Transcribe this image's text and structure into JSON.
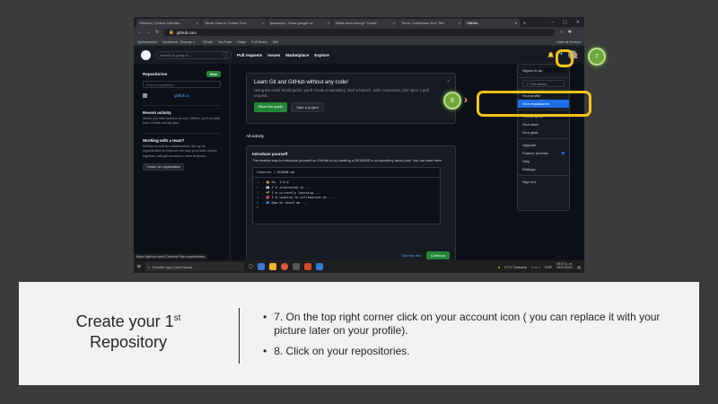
{
  "browser": {
    "tabs": [
      {
        "label": "Director | Online Courses -",
        "active": false
      },
      {
        "label": "Tema: How to Create Your",
        "active": false
      },
      {
        "label": "javascript - Pass google sc",
        "active": false
      },
      {
        "label": "What went wrong? Troubl",
        "active": false
      },
      {
        "label": "Tema: Customize Your Terr",
        "active": false
      },
      {
        "label": "GitHub",
        "active": true
      }
    ],
    "new_tab": "+",
    "url": "github.com",
    "bookmarks": [
      "Aplicaciones",
      "facebook - Buscar c...",
      "Gmail",
      "YouTube",
      "Maps",
      "Full Stack",
      "DM"
    ],
    "reading_list": "Lista de lectura"
  },
  "github": {
    "search_placeholder": "Search or jump to...",
    "search_key": "/",
    "nav": [
      "Pull requests",
      "Issues",
      "Marketplace",
      "Explore"
    ],
    "sidebar": {
      "repos_title": "Repositories",
      "new_label": "New",
      "find_placeholder": "Find a repository...",
      "repo_name": "github.io",
      "recent_title": "Recent activity",
      "recent_text": "When you take actions across GitHub, we'll provide links to that activity here.",
      "team_title": "Working with a team?",
      "team_text": "GitHub is built for collaboration. Set up an organization to improve the way your team works together, and get access to more features.",
      "org_button": "Create an organization"
    },
    "welcome": {
      "title": "Learn Git and GitHub without any code!",
      "text": "Using the Hello World guide, you'll create a repository, start a branch, write comments, and open a pull request.",
      "read_button": "Read the guide",
      "start_button": "Start a project",
      "close": "×"
    },
    "activity_title": "All activity",
    "intro": {
      "title": "Introduce yourself",
      "text": "The easiest way to introduce yourself on GitHub is by creating a README in a repository about you! You can start here:",
      "file": "CJamrcel / README.md",
      "lines": [
        {
          "n": "1",
          "t": "- 👋 Hi, I'm @"
        },
        {
          "n": "2",
          "t": "- 👀 I'm interested in ..."
        },
        {
          "n": "3",
          "t": "- 🌱 I'm currently learning ..."
        },
        {
          "n": "4",
          "t": "- 💞 I'm looking to collaborate on ..."
        },
        {
          "n": "5",
          "t": "- 📫 How to reach me ..."
        },
        {
          "n": "6",
          "t": ""
        }
      ],
      "dismiss": "Dismiss this",
      "continue": "Continue"
    },
    "dropdown": {
      "signed_in": "Signed in as",
      "set_status": "Set status",
      "items_a": [
        "Your profile",
        "Your repositories"
      ],
      "items_b": [
        "Your projects",
        "Your stars",
        "Your gists"
      ],
      "items_c": [
        "Upgrade",
        "Feature preview",
        "Help",
        "Settings"
      ],
      "sign_out": "Sign out"
    },
    "status_url": "https://github.com/CJamrcel?tab=repositories"
  },
  "taskbar": {
    "search_placeholder": "Escribe aquí para buscar",
    "weather": "27°C Soleado",
    "lang": "ESP",
    "time": "04:57 p. m.",
    "date": "06/07/2021"
  },
  "annotations": {
    "step7": "7",
    "step8": "8"
  },
  "caption": {
    "title_a": "Create your 1",
    "title_sup": "st",
    "title_b": "Repository",
    "bullets": [
      "7. On the top right corner click on your account icon ( you can replace it with your picture later on your profile).",
      "8. Click on your repositories."
    ]
  },
  "colors": {
    "highlight": "#f5c219",
    "badge": "#6fa83a",
    "github_green": "#238636",
    "github_link": "#58a6ff"
  }
}
